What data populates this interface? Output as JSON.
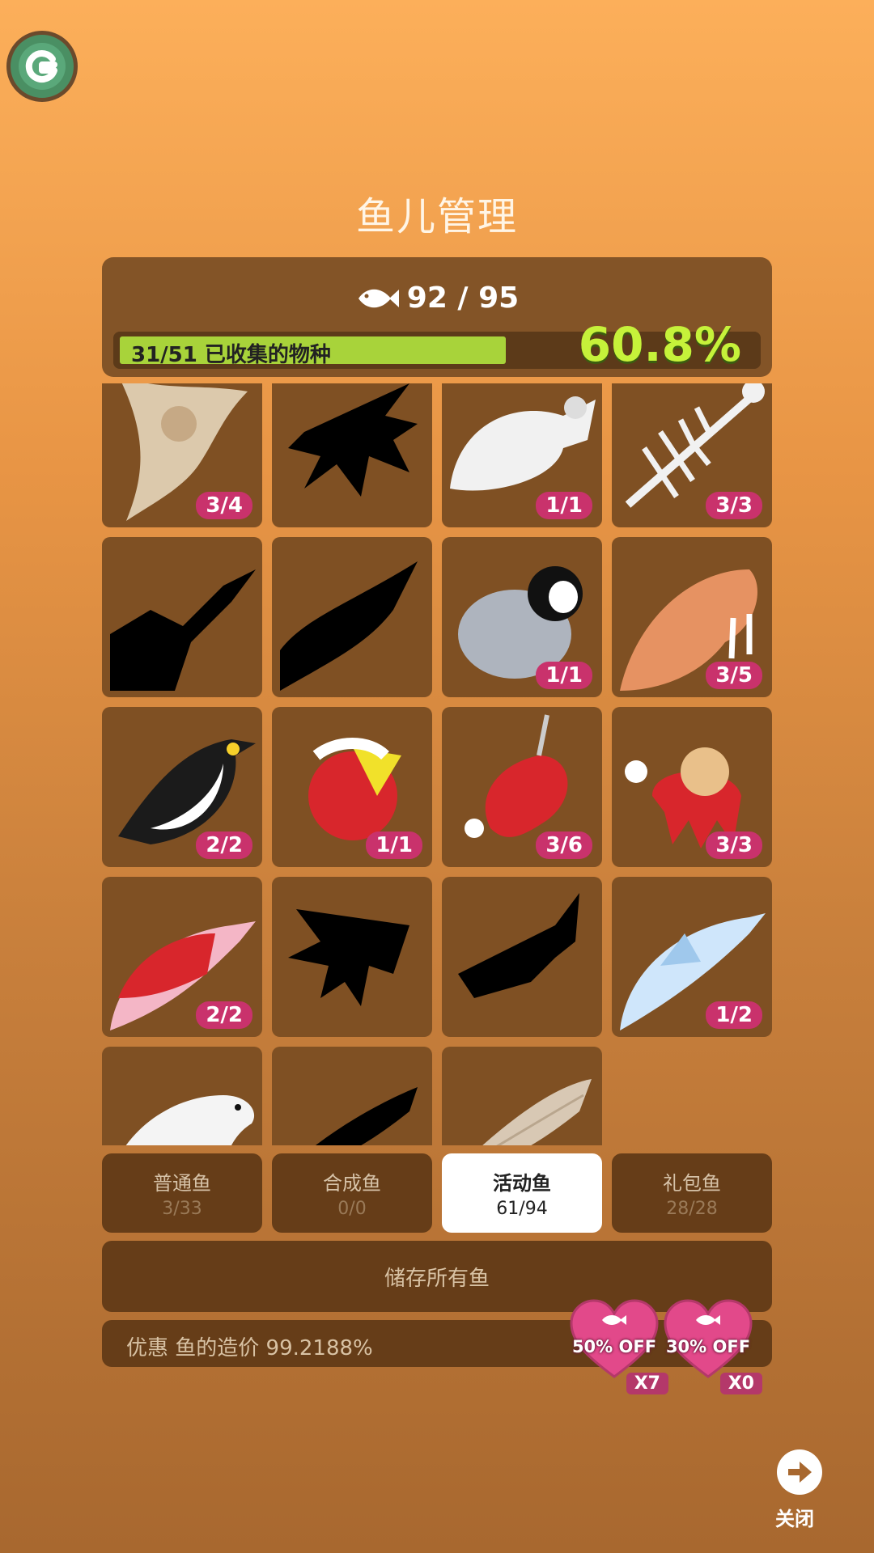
{
  "app": {
    "logo": "g-logo-icon"
  },
  "page": {
    "title": "鱼儿管理"
  },
  "header": {
    "fish_icon": "fish-icon",
    "fish_count": "92 / 95",
    "collected_label": "31/51 已收集的物种",
    "collected_fraction": 0.608,
    "percent": "60.8%"
  },
  "creatures": [
    {
      "name": "manta-ray-fossil",
      "count": "3/4",
      "color": "#dcc9ac",
      "silhouette": false
    },
    {
      "name": "spiky-fish-silhouette",
      "count": "",
      "color": "#000000",
      "silhouette": true
    },
    {
      "name": "turtle-skeleton",
      "count": "1/1",
      "color": "#f1f1f1",
      "silhouette": false
    },
    {
      "name": "fish-skeleton",
      "count": "3/3",
      "color": "#f1f1f1",
      "silhouette": false
    },
    {
      "name": "crab-silhouette",
      "count": "",
      "color": "#000000",
      "silhouette": true
    },
    {
      "name": "sawfish-silhouette",
      "count": "",
      "color": "#000000",
      "silhouette": true
    },
    {
      "name": "penguin-chick",
      "count": "1/1",
      "color": "#aeb4be",
      "silhouette": false
    },
    {
      "name": "walrus",
      "count": "3/5",
      "color": "#e69262",
      "silhouette": false
    },
    {
      "name": "emperor-penguin",
      "count": "2/2",
      "color": "#1b1b1b",
      "silhouette": false
    },
    {
      "name": "santa-yellow-fish",
      "count": "1/1",
      "color": "#d8262c",
      "silhouette": false
    },
    {
      "name": "santa-seahorse",
      "count": "3/6",
      "color": "#d8262c",
      "silhouette": false
    },
    {
      "name": "santa-octopus",
      "count": "3/3",
      "color": "#d8262c",
      "silhouette": false
    },
    {
      "name": "santa-pink-dolphin",
      "count": "2/2",
      "color": "#d8262c",
      "silhouette": false
    },
    {
      "name": "spiky-creature-silhouette",
      "count": "",
      "color": "#000000",
      "silhouette": true
    },
    {
      "name": "rocky-creature-silhouette",
      "count": "",
      "color": "#000000",
      "silhouette": true
    },
    {
      "name": "ice-dolphin",
      "count": "1/2",
      "color": "#cfe6fb",
      "silhouette": false
    },
    {
      "name": "polar-bear",
      "count": "",
      "color": "#f4f4f4",
      "silhouette": false
    },
    {
      "name": "whale-silhouette",
      "count": "",
      "color": "#000000",
      "silhouette": true
    },
    {
      "name": "humpback-whale",
      "count": "",
      "color": "#d8c8b4",
      "silhouette": false
    }
  ],
  "tabs": [
    {
      "label": "普通鱼",
      "count": "3/33",
      "active": false
    },
    {
      "label": "合成鱼",
      "count": "0/0",
      "active": false
    },
    {
      "label": "活动鱼",
      "count": "61/94",
      "active": true
    },
    {
      "label": "礼包鱼",
      "count": "28/28",
      "active": false
    }
  ],
  "store_button": {
    "label": "储存所有鱼"
  },
  "discount": {
    "text": "优惠 鱼的造价 99.2188%",
    "coupons": [
      {
        "label": "50% OFF",
        "multiplier": "X7"
      },
      {
        "label": "30% OFF",
        "multiplier": "X0"
      }
    ]
  },
  "close": {
    "label": "关闭",
    "icon": "arrow-right-icon"
  },
  "colors": {
    "panel": "#835427",
    "tab_bg": "#663d18",
    "progress_fill": "#a8d33a",
    "percent_text": "#c6f23a",
    "badge": "#c9326c",
    "heart": "#e2498a"
  }
}
